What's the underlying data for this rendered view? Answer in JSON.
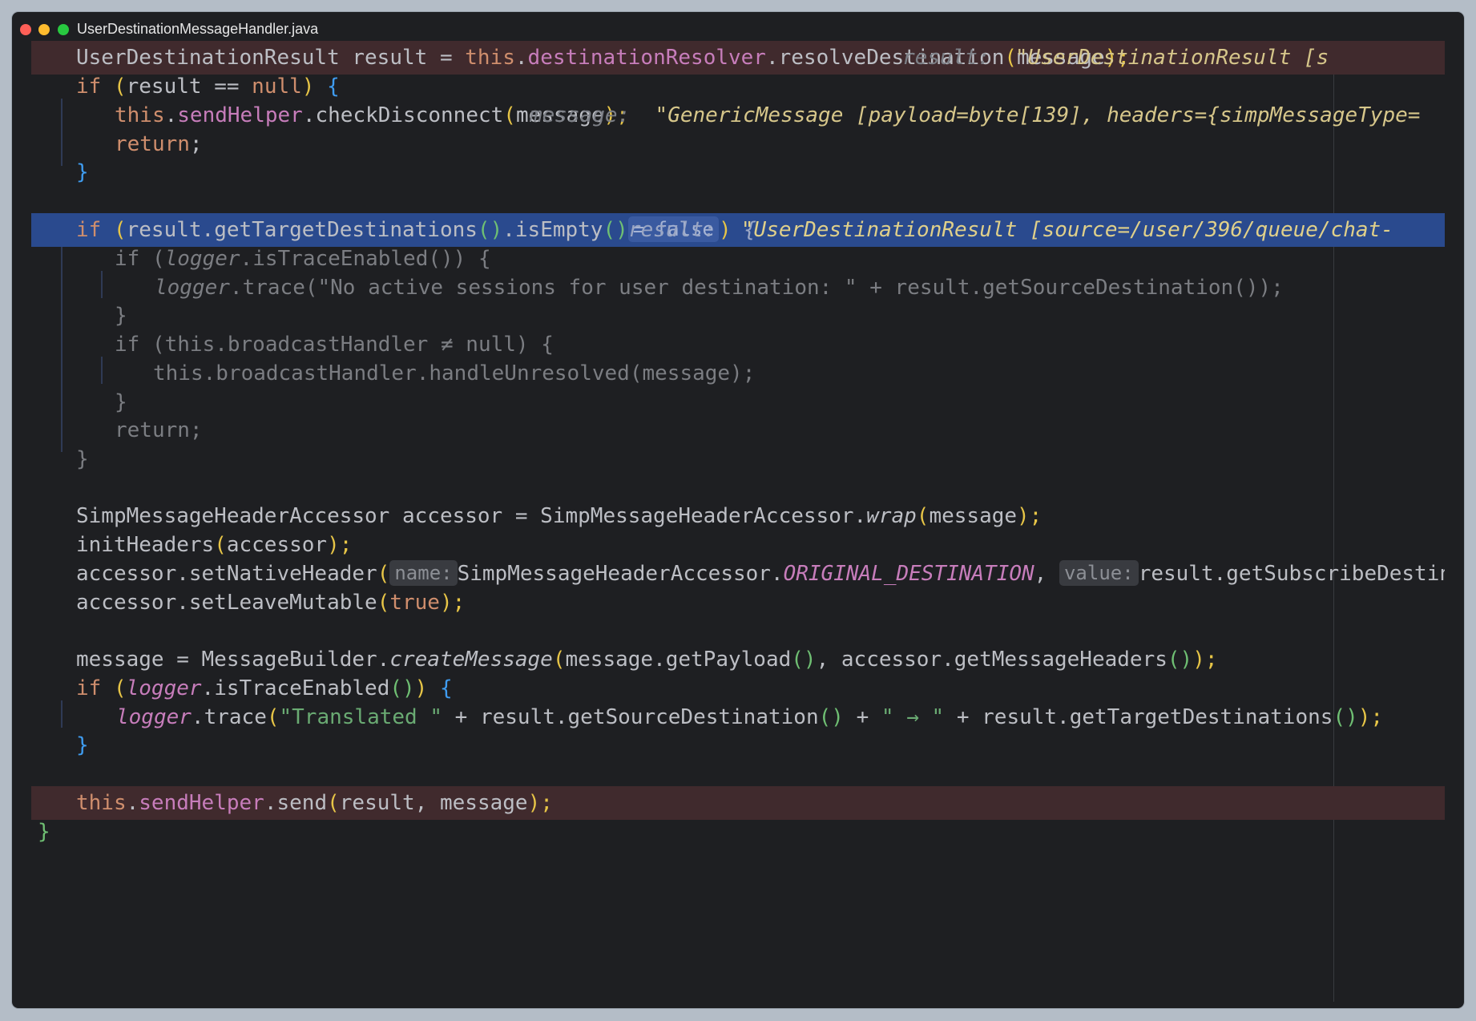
{
  "window": {
    "title": "UserDestinationMessageHandler.java"
  },
  "code": {
    "l01": {
      "a": "UserDestinationResult result = ",
      "b": "this",
      "c": ".",
      "d": "destinationResolver",
      "e": ".resolveDestination",
      "f": "(",
      "g": "message",
      "h": ");",
      "hint_name": "result:",
      "hint_value": "\"UserDestinationResult [s"
    },
    "l02": {
      "a": "if ",
      "b": "(",
      "c": "result == ",
      "d": "null",
      "e": ")",
      "f": " {"
    },
    "l03": {
      "a": "this",
      "b": ".",
      "c": "sendHelper",
      "d": ".checkDisconnect",
      "e": "(",
      "f": "message",
      "g": ");",
      "hint_name": "message:",
      "hint_value": "\"GenericMessage [payload=byte[139], headers={simpMessageType="
    },
    "l04": {
      "a": "return",
      "b": ";"
    },
    "l05": {
      "a": "}"
    },
    "l06": {
      "a": "if ",
      "b": "(",
      "c": "result.getTargetDestinations",
      "d": "()",
      "e": ".isEmpty",
      "f": "()",
      "g": "= false",
      "h": ")",
      "i": " {",
      "hint_name": "result:",
      "hint_value": "\"UserDestinationResult [source=/user/396/queue/chat-"
    },
    "l07": {
      "a": "if (",
      "b": "logger",
      "c": ".isTraceEnabled()) {"
    },
    "l08": {
      "a": "logger",
      "b": ".trace(\"No active sessions for user destination: \" + result.getSourceDestination());"
    },
    "l09": {
      "a": "}"
    },
    "l10": {
      "a": "if (this.broadcastHandler ≠ null) {"
    },
    "l11": {
      "a": "this.broadcastHandler.handleUnresolved(message);"
    },
    "l12": {
      "a": "}"
    },
    "l13": {
      "a": "return;"
    },
    "l14": {
      "a": "}"
    },
    "l15": {
      "a": "SimpMessageHeaderAccessor accessor = SimpMessageHeaderAccessor.",
      "b": "wrap",
      "c": "(",
      "d": "message",
      "e": ");"
    },
    "l16": {
      "a": "initHeaders",
      "b": "(",
      "c": "accessor",
      "d": ");"
    },
    "l17": {
      "a": "accessor.setNativeHeader",
      "b": "(",
      "hint_name": "name:",
      "c": "SimpMessageHeaderAccessor.",
      "d": "ORIGINAL_DESTINATION",
      "e": ",",
      "hint_value": "value:",
      "f": "result.getSubscribeDestination",
      "g": "()",
      "h": ");"
    },
    "l18": {
      "a": "accessor.setLeaveMutable",
      "b": "(",
      "c": "true",
      "d": ");"
    },
    "l19": {
      "a": "message = MessageBuilder.",
      "b": "createMessage",
      "c": "(",
      "d": "message.getPayload",
      "e": "()",
      "f": ", accessor.getMessageHeaders",
      "g": "()",
      "h": ");"
    },
    "l20": {
      "a": "if ",
      "b": "(",
      "c": "logger",
      "d": ".isTraceEnabled",
      "e": "()",
      "f": ")",
      "g": " {"
    },
    "l21": {
      "a": "logger",
      "b": ".trace",
      "c": "(",
      "d": "\"Translated \"",
      "e": " + result.getSourceDestination",
      "f": "()",
      "g": " + ",
      "h": "\" → \"",
      "i": " + result.getTargetDestinations",
      "j": "()",
      "k": ");"
    },
    "l22": {
      "a": "}"
    },
    "l23": {
      "a": "this",
      "b": ".",
      "c": "sendHelper",
      "d": ".send",
      "e": "(",
      "f": "result, message",
      "g": ");"
    },
    "l24": {
      "a": "}"
    }
  },
  "colors": {
    "background": "#1e1f22",
    "breakpoint_line": "#402a2d",
    "execution_line": "#2a4a8e",
    "keyword": "#cf8e6d",
    "field": "#c77dbb",
    "string": "#6aab73",
    "text": "#bcbec4"
  }
}
